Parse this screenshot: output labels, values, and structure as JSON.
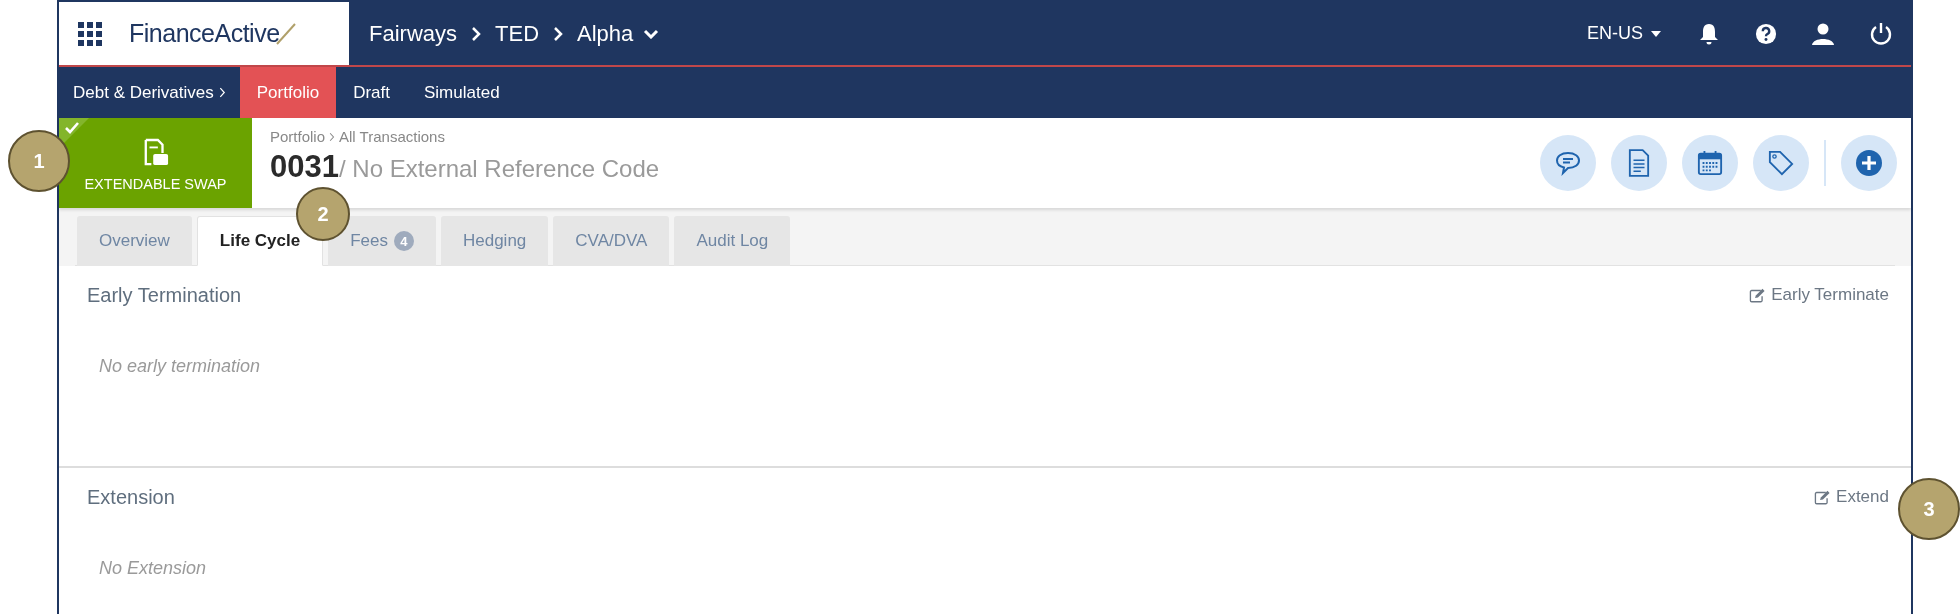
{
  "header": {
    "logo": "Finance**Active**",
    "breadcrumb": [
      {
        "label": "Fairways"
      },
      {
        "label": "TED"
      },
      {
        "label": "Alpha"
      }
    ],
    "language": "EN-US"
  },
  "subnav": {
    "root": "Debt & Derivatives",
    "items": [
      {
        "label": "Portfolio",
        "selected": true
      },
      {
        "label": "Draft",
        "selected": false
      },
      {
        "label": "Simulated",
        "selected": false
      }
    ]
  },
  "deal": {
    "type": "EXTENDABLE SWAP",
    "validated": true,
    "breadcrumb": [
      "Portfolio",
      "All Transactions"
    ],
    "number": "0031",
    "reference": "/ No External Reference Code"
  },
  "tabs": [
    {
      "label": "Overview",
      "selected": false
    },
    {
      "label": "Life Cycle",
      "selected": true
    },
    {
      "label": "Fees",
      "badge": "4",
      "selected": false
    },
    {
      "label": "Hedging",
      "selected": false
    },
    {
      "label": "CVA/DVA",
      "selected": false
    },
    {
      "label": "Audit Log",
      "selected": false
    }
  ],
  "sections": [
    {
      "title": "Early Termination",
      "action": "Early Terminate",
      "empty": "No early termination"
    },
    {
      "title": "Extension",
      "action": "Extend",
      "empty": "No Extension"
    }
  ],
  "callouts": [
    "1",
    "2",
    "3"
  ]
}
